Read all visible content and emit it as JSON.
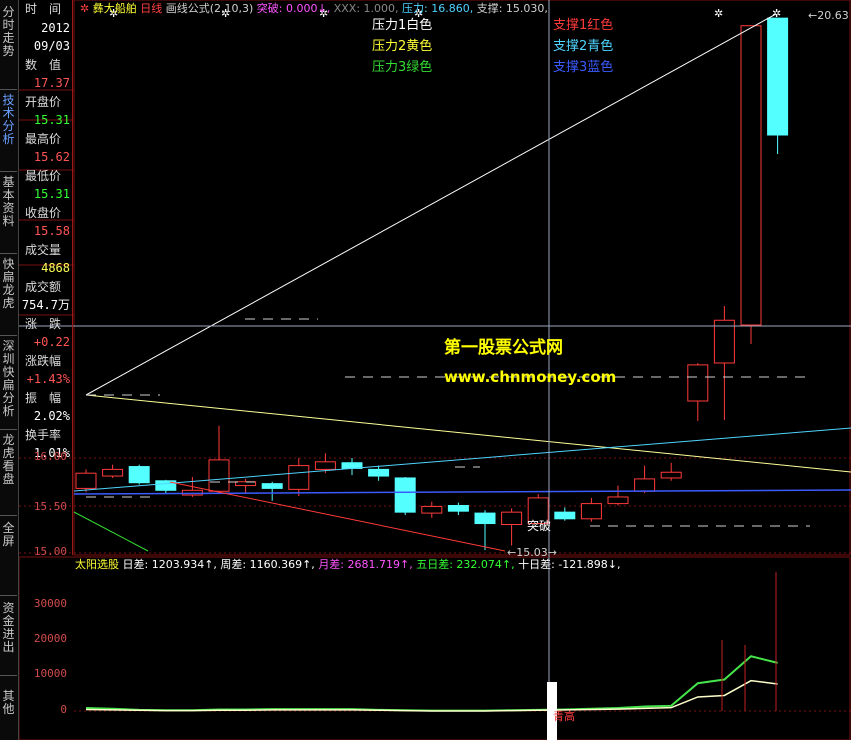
{
  "sidebar": {
    "tabs": [
      {
        "label": "分时走势",
        "active": false
      },
      {
        "label": "技术分析",
        "active": true
      },
      {
        "label": "基本资料",
        "active": false
      },
      {
        "label": "快扁龙虎",
        "active": false
      },
      {
        "label": "深圳快扁分析",
        "active": false
      },
      {
        "label": "龙虎看盘",
        "active": false
      },
      {
        "label": "全屏",
        "active": false
      },
      {
        "label": "资金进出",
        "active": false
      },
      {
        "label": "其他",
        "active": false
      }
    ]
  },
  "info": {
    "time_label": "时　间",
    "year": "2012",
    "date": "09/03",
    "value_label": "数　值",
    "value": "17.37",
    "open_label": "开盘价",
    "open": "15.31",
    "high_label": "最高价",
    "high": "15.62",
    "low_label": "最低价",
    "low": "15.31",
    "close_label": "收盘价",
    "close": "15.58",
    "volume_label": "成交量",
    "volume": "4868",
    "amount_label": "成交额",
    "amount": "754.7万",
    "change_label": "涨　跌",
    "change": "+0.22",
    "pct_label": "涨跌幅",
    "pct": "+1.43%",
    "amp_label": "振　幅",
    "amp": "2.02%",
    "turnover_label": "换手率",
    "turnover": "1.01%"
  },
  "header": {
    "title": "彝大船舶",
    "period": "日线",
    "formula": "画线公式(2,10,3)",
    "breakout": "突破: 0.000↓,",
    "xxx": "XXX: 1.000,",
    "pressure": "压力: 16.860,",
    "support": "支撑: 15.030,"
  },
  "legend": {
    "p1": "压力1白色",
    "p2": "压力2黄色",
    "p3": "压力3绿色",
    "s1": "支撑1红色",
    "s2": "支撑2青色",
    "s3": "支撑3蓝色"
  },
  "watermark": {
    "line1": "第一股票公式网",
    "line2": "www.chnmoney.com"
  },
  "annotations": {
    "max_label": "20.63",
    "min_label": "15.03",
    "breakout_label": "突破",
    "bottom_mark": "青高"
  },
  "sub_header": {
    "name": "太阳选股",
    "d1": "日差: 1203.934↑,",
    "w": "周差: 1160.369↑,",
    "m": "月差: 2681.719↑,",
    "d5": "五日差: 232.074↑,",
    "d10": "十日差: -121.898↓,"
  },
  "colors": {
    "up": "#ff3a3a",
    "down": "#54ffff",
    "grid": "#7a1010",
    "white": "#ffffff",
    "yellow": "#ffff00",
    "green": "#33dd33",
    "cyan": "#4fd4ff",
    "blue": "#3b5bff",
    "magenta": "#ff55ff"
  },
  "chart_data": {
    "type": "candlestick",
    "y_axis_ticks": [
      "16.00",
      "15.50",
      "15.00"
    ],
    "sub_y_axis_ticks": [
      "30000",
      "20000",
      "10000",
      "0"
    ],
    "candles": [
      {
        "o": 15.68,
        "c": 15.84,
        "h": 15.88,
        "l": 15.64
      },
      {
        "o": 15.81,
        "c": 15.88,
        "h": 15.93,
        "l": 15.79
      },
      {
        "o": 15.91,
        "c": 15.74,
        "h": 15.93,
        "l": 15.72
      },
      {
        "o": 15.76,
        "c": 15.66,
        "h": 15.77,
        "l": 15.62
      },
      {
        "o": 15.61,
        "c": 15.66,
        "h": 15.8,
        "l": 15.59
      },
      {
        "o": 15.65,
        "c": 15.98,
        "h": 16.34,
        "l": 15.62
      },
      {
        "o": 15.71,
        "c": 15.75,
        "h": 15.78,
        "l": 15.63
      },
      {
        "o": 15.73,
        "c": 15.68,
        "h": 15.75,
        "l": 15.55
      },
      {
        "o": 15.67,
        "c": 15.92,
        "h": 16.0,
        "l": 15.6
      },
      {
        "o": 15.88,
        "c": 15.96,
        "h": 16.05,
        "l": 15.84
      },
      {
        "o": 15.95,
        "c": 15.89,
        "h": 16.0,
        "l": 15.82
      },
      {
        "o": 15.88,
        "c": 15.81,
        "h": 15.92,
        "l": 15.76
      },
      {
        "o": 15.79,
        "c": 15.43,
        "h": 15.8,
        "l": 15.4
      },
      {
        "o": 15.42,
        "c": 15.49,
        "h": 15.54,
        "l": 15.37
      },
      {
        "o": 15.5,
        "c": 15.44,
        "h": 15.53,
        "l": 15.4
      },
      {
        "o": 15.42,
        "c": 15.31,
        "h": 15.45,
        "l": 15.03
      },
      {
        "o": 15.3,
        "c": 15.43,
        "h": 15.47,
        "l": 15.08
      },
      {
        "o": 15.31,
        "c": 15.58,
        "h": 15.62,
        "l": 15.31
      },
      {
        "o": 15.43,
        "c": 15.36,
        "h": 15.48,
        "l": 15.34
      },
      {
        "o": 15.36,
        "c": 15.52,
        "h": 15.58,
        "l": 15.33
      },
      {
        "o": 15.52,
        "c": 15.59,
        "h": 15.71,
        "l": 15.5
      },
      {
        "o": 15.65,
        "c": 15.78,
        "h": 15.92,
        "l": 15.63
      },
      {
        "o": 15.79,
        "c": 15.85,
        "h": 15.95,
        "l": 15.76
      },
      {
        "o": 16.6,
        "c": 16.98,
        "h": 17.0,
        "l": 16.39
      },
      {
        "o": 17.0,
        "c": 17.45,
        "h": 17.6,
        "l": 16.4
      },
      {
        "o": 17.4,
        "c": 20.55,
        "h": 20.55,
        "l": 17.2
      },
      {
        "o": 20.63,
        "c": 19.4,
        "h": 20.63,
        "l": 19.2
      }
    ],
    "price_range": [
      14.97,
      20.8
    ],
    "sub_range": [
      -2000,
      40000
    ]
  }
}
